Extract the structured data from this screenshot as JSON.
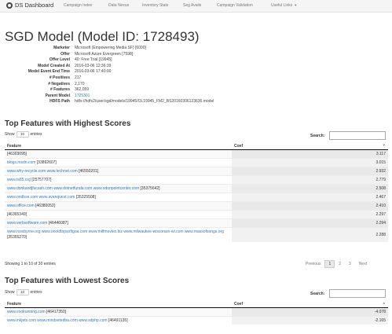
{
  "navbar": {
    "brand": "DS Dashboard",
    "items": [
      "Campaign Index",
      "Data Nexus",
      "Inventory Stats",
      "Seg Avails",
      "Campaign Validation",
      "Useful Links"
    ]
  },
  "page": {
    "title": "SGD Model (Model ID: 1728493)"
  },
  "meta": [
    {
      "key": "Marketer",
      "value": "Microsoft (Empowering Media SF) [6000]"
    },
    {
      "key": "Offer",
      "value": "Microsoft Azure Evergreen [7598]"
    },
    {
      "key": "Offer Level",
      "value": "40: Free Trial [19945]"
    },
    {
      "key": "Model Created At",
      "value": "2016-03-06 12:36:39"
    },
    {
      "key": "Model Event End Time",
      "value": "2016-03-06 17:40:00"
    },
    {
      "key": "# Positives",
      "value": "217"
    },
    {
      "key": "# Negatives",
      "value": "2,170"
    },
    {
      "key": "# Features",
      "value": "362,059"
    },
    {
      "key": "Parent Model",
      "value": "1725301"
    },
    {
      "key": "HDFS Path",
      "value": "hdfs://hdfs2/user/sgd/models/19945/OL19945_FM2_BS20160306123636.model"
    }
  ],
  "controls": {
    "show": "Show",
    "entries_value": "10",
    "entries": "entries",
    "search": "Search:"
  },
  "top": {
    "title": "Top Features with Highest Scores",
    "headers": [
      "Feature",
      "Coef"
    ],
    "rows": [
      {
        "link": "",
        "id": "[46303095]",
        "coef": "3.117"
      },
      {
        "link": "blogs.msdn.com",
        "id": "[33892607]",
        "coef": "3.015"
      },
      {
        "link": "www.why-recycle.com www.technet.com",
        "id": "[46550201]",
        "coef": "2.932"
      },
      {
        "link": "www.ts85.org",
        "id": "[25757707]",
        "coef": "2.779"
      },
      {
        "link": "www.donkandjfucash.com www.dotnetfunda.com www.odonpointcenter.com",
        "id": "[35375642]",
        "coef": "2.508"
      },
      {
        "link": "www.ondbse.com www.avanquest.com",
        "id": "[35325508]",
        "coef": "2.467"
      },
      {
        "link": "www.office.com",
        "id": "[46380052]",
        "coef": "2.410"
      },
      {
        "link": "",
        "id": "[46365349]",
        "coef": "2.297"
      },
      {
        "link": "www.verbsoftware.com",
        "id": "[46446087]",
        "coef": "2.294"
      },
      {
        "link": "www.rossbyrne.org www.onoldtopsoftgoa.com www.milfmovies.biz www.milwaukee-wisconsin-wi.com www.massofsongs.org",
        "id": "[35355270]",
        "coef": "2.288"
      }
    ],
    "info": "Showing 1 to 10 of 30 entries",
    "pager": {
      "prev": "Previous",
      "pages": [
        "1",
        "2",
        "3"
      ],
      "next": "Next"
    }
  },
  "bottom": {
    "title": "Top Features with Lowest Scores",
    "headers": [
      "Feature",
      "Coef"
    ],
    "rows": [
      {
        "link": "www.coolrunning.com",
        "id": "[46417350]",
        "coef": "-4.078"
      },
      {
        "link": "www.inkjets.com www.mindsetedba.com www.sdphp.com",
        "id": "[46491135]",
        "coef": "-2.165"
      }
    ]
  }
}
